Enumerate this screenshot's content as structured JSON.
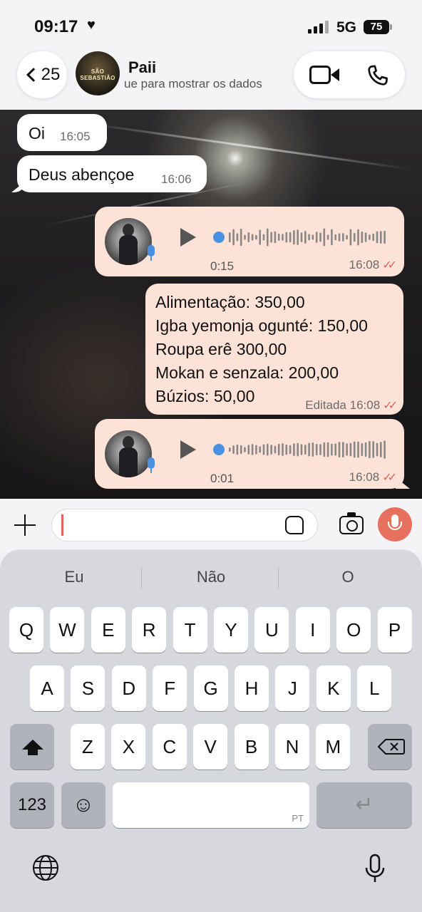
{
  "status": {
    "time": "09:17",
    "network": "5G",
    "battery": "75"
  },
  "header": {
    "back_count": "25",
    "contact_name": "Paii",
    "contact_subtitle": "ue para mostrar os dados",
    "avatar_text": "SÃO SEBASTIÃO"
  },
  "messages": {
    "m1": {
      "text": "Oi",
      "time": "16:05"
    },
    "m2": {
      "text": "Deus abençoe",
      "time": "16:06"
    },
    "v1": {
      "duration": "0:15",
      "time": "16:08"
    },
    "list": {
      "lines": [
        "Alimentação: 350,00",
        "Igba yemonja ogunté: 150,00",
        "Roupa erê 300,00",
        "Mokan e senzala: 200,00",
        "Búzios: 50,00"
      ],
      "edited": "Editada",
      "time": "16:08"
    },
    "v2": {
      "duration": "0:01",
      "time": "16:08"
    }
  },
  "composer": {
    "value": ""
  },
  "keyboard": {
    "suggestions": [
      "Eu",
      "Não",
      "O"
    ],
    "row1": [
      "Q",
      "W",
      "E",
      "R",
      "T",
      "Y",
      "U",
      "I",
      "O",
      "P"
    ],
    "row2": [
      "A",
      "S",
      "D",
      "F",
      "G",
      "H",
      "J",
      "K",
      "L"
    ],
    "row3": [
      "Z",
      "X",
      "C",
      "V",
      "B",
      "N",
      "M"
    ],
    "numbers_key": "123",
    "emoji_key": "☺",
    "space_lang": "PT"
  },
  "colors": {
    "outgoing_bubble": "#fde2d8",
    "accent": "#e26356",
    "audio_dot": "#4a90e2"
  }
}
